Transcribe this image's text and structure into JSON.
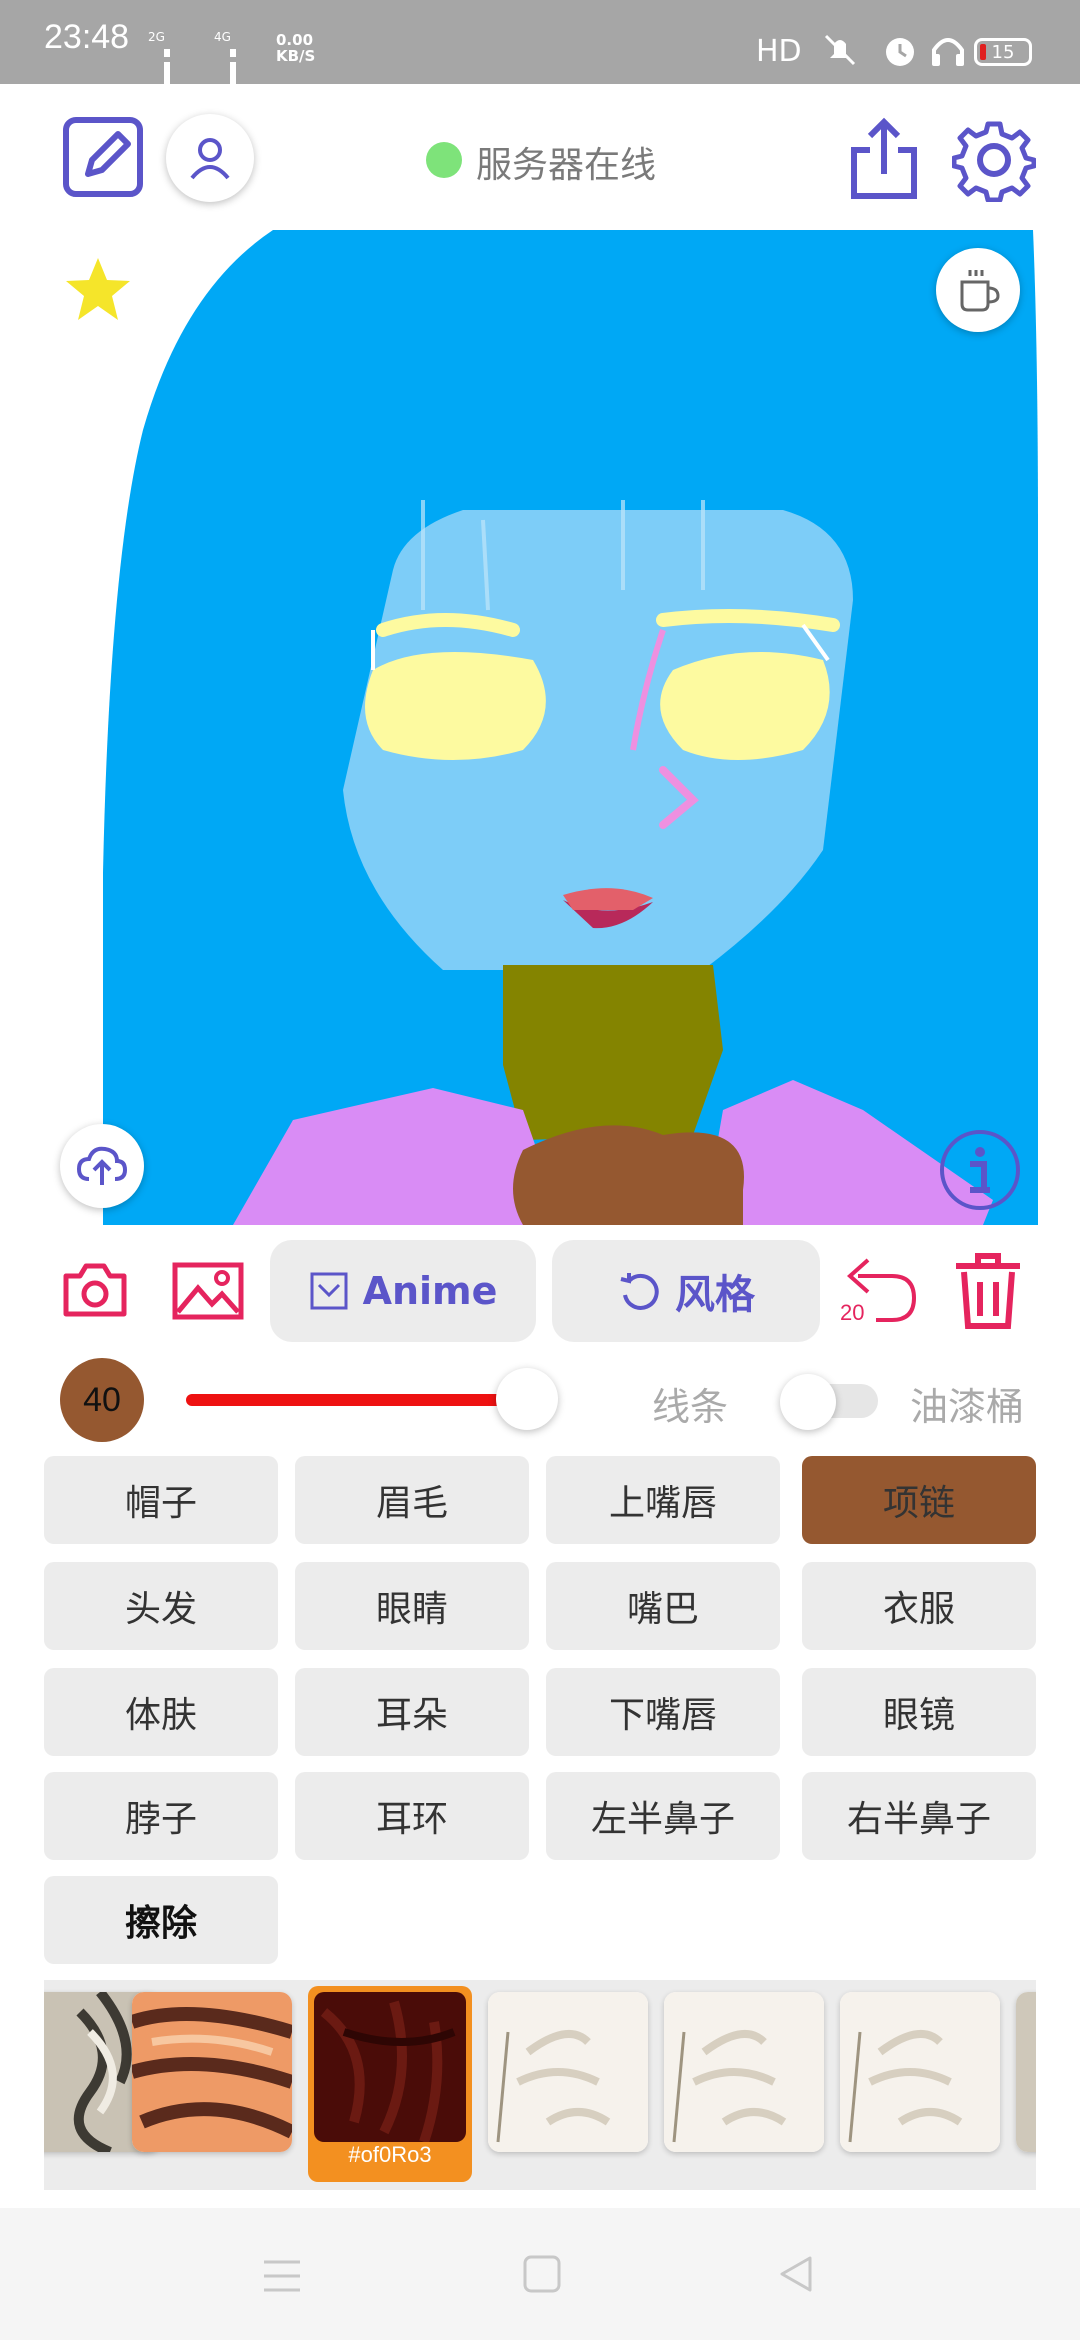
{
  "status_bar": {
    "time": "23:48",
    "net1": "2G",
    "net2": "4G",
    "speed_value": "0.00",
    "speed_unit": "KB/S",
    "hd": "HD",
    "battery": "15"
  },
  "top_bar": {
    "server_status": "服务器在线",
    "server_status_color": "#7ee37a"
  },
  "toolbar": {
    "anime_label": "Anime",
    "style_label": "风格",
    "undo_count": "20"
  },
  "brush": {
    "size": "40",
    "size_color": "#955830",
    "slider_value_fraction": 0.82,
    "slider_color": "#ee1111",
    "line_label": "线条",
    "bucket_label": "油漆桶"
  },
  "parts": [
    {
      "label": "帽子",
      "active": false
    },
    {
      "label": "眉毛",
      "active": false
    },
    {
      "label": "上嘴唇",
      "active": false
    },
    {
      "label": "项链",
      "active": true
    },
    {
      "label": "头发",
      "active": false
    },
    {
      "label": "眼睛",
      "active": false
    },
    {
      "label": "嘴巴",
      "active": false
    },
    {
      "label": "衣服",
      "active": false
    },
    {
      "label": "体肤",
      "active": false
    },
    {
      "label": "耳朵",
      "active": false
    },
    {
      "label": "下嘴唇",
      "active": false
    },
    {
      "label": "眼镜",
      "active": false
    },
    {
      "label": "脖子",
      "active": false
    },
    {
      "label": "耳环",
      "active": false
    },
    {
      "label": "左半鼻子",
      "active": false
    },
    {
      "label": "右半鼻子",
      "active": false
    },
    {
      "label": "擦除",
      "active": false
    }
  ],
  "swatches": {
    "selected_label": "#of0Ro3",
    "selected_color": "#f39020"
  },
  "colors": {
    "accent": "#5b55c9",
    "danger": "#e5245e",
    "hair": "#00a8f5",
    "skin": "#7dcdf8",
    "eyes": "#fdfaa0",
    "neck": "#848400",
    "necklace": "#955830",
    "clothes": "#d98cf5"
  }
}
